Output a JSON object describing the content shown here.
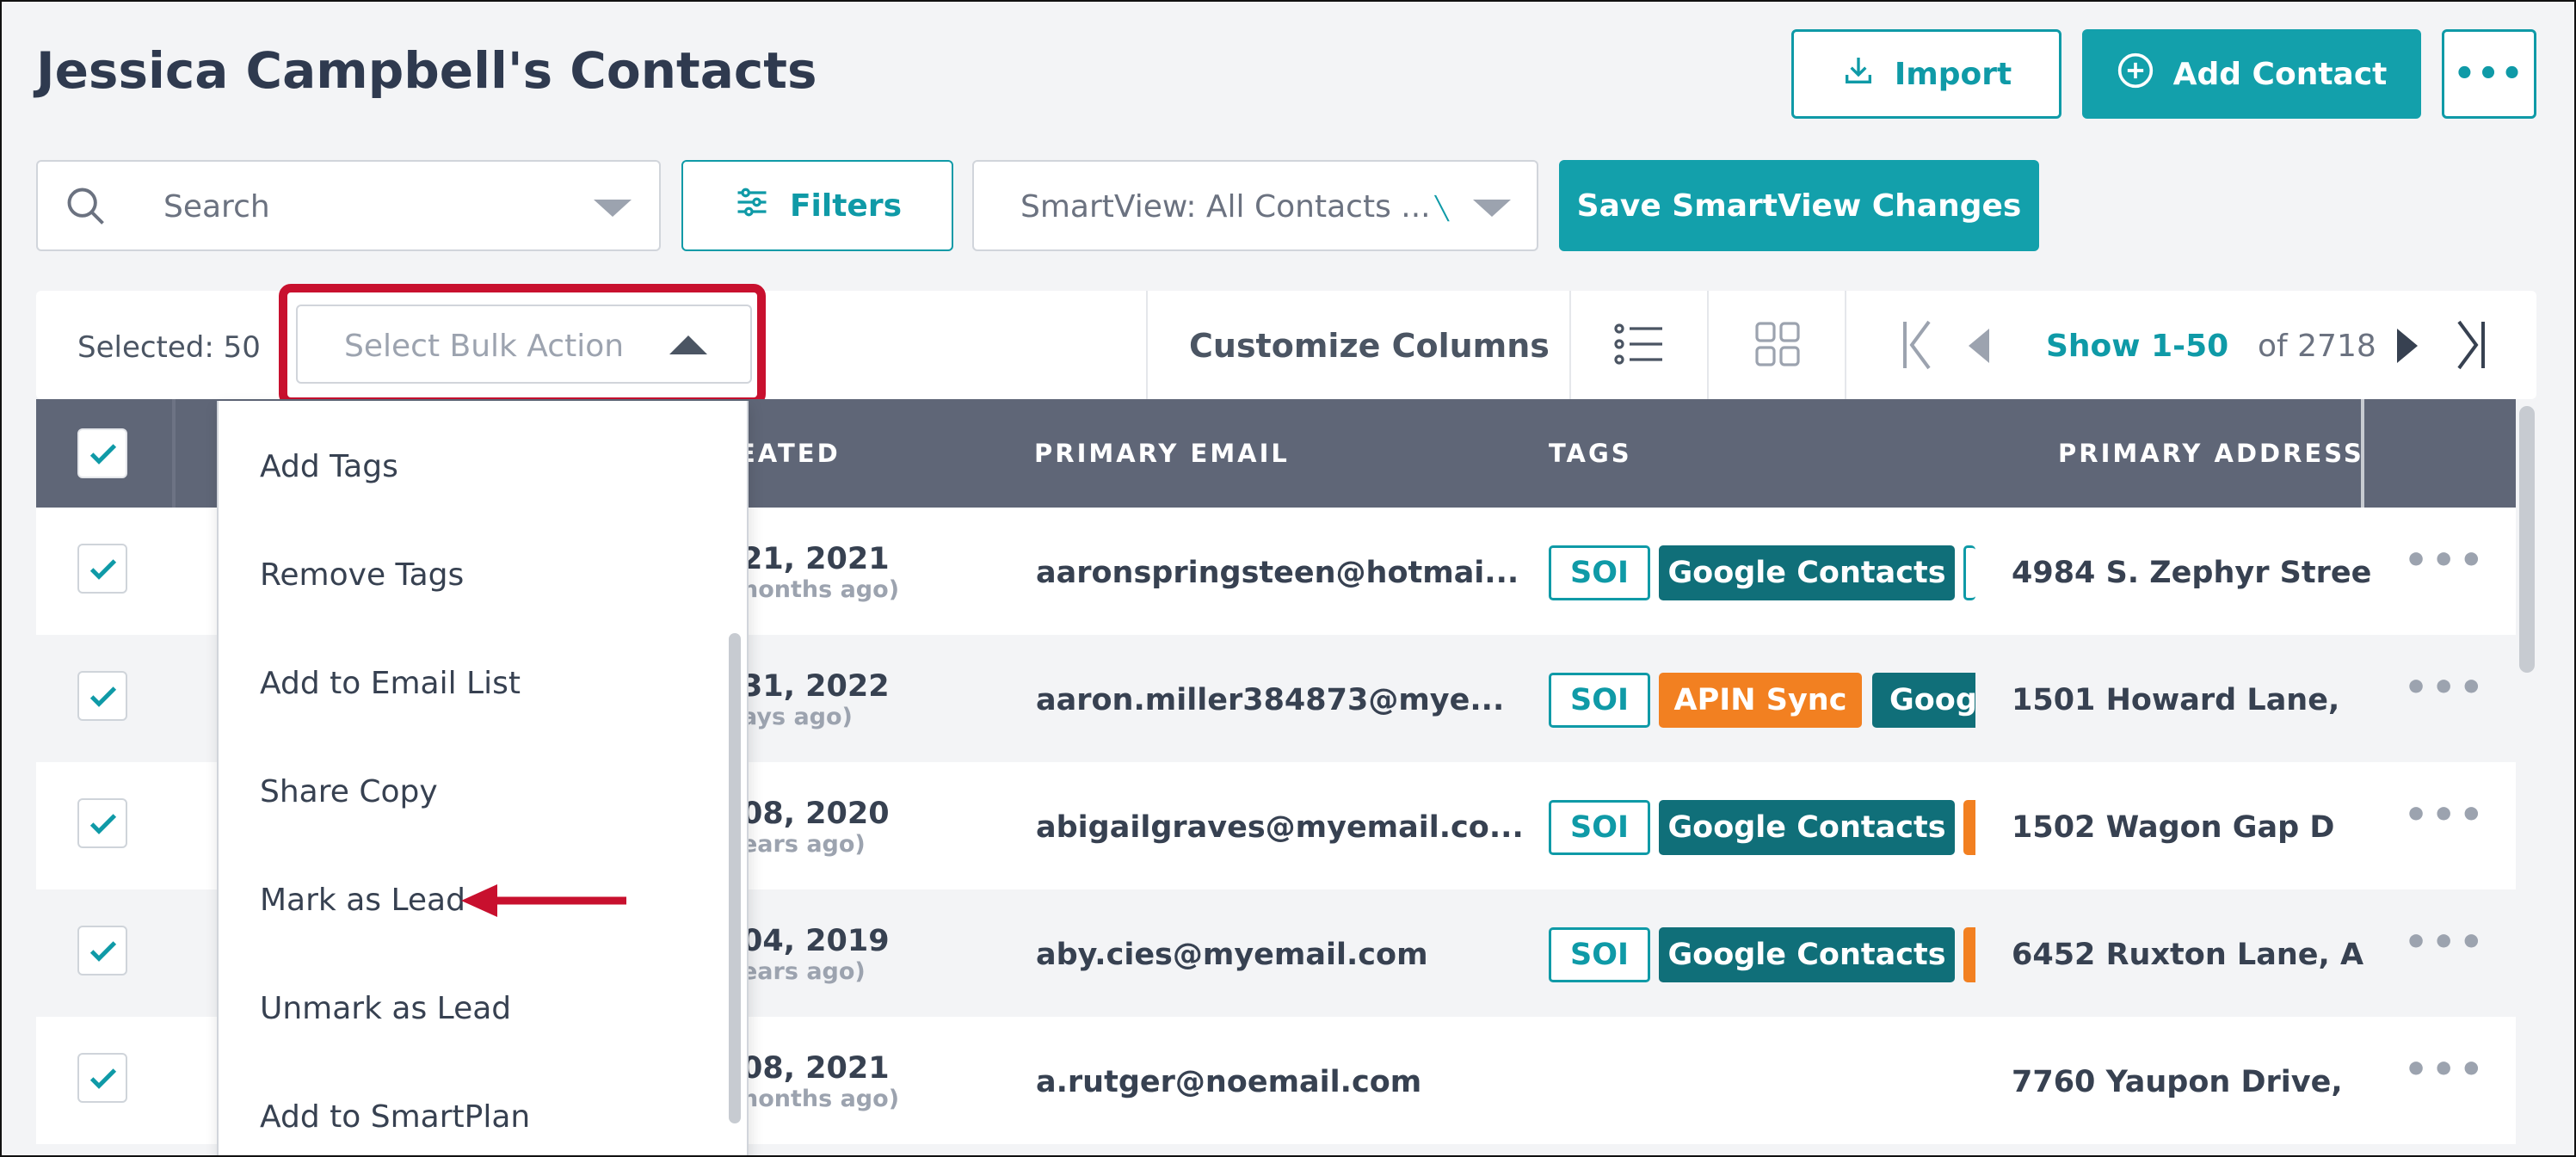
{
  "header": {
    "title": "Jessica Campbell's Contacts",
    "import_label": "Import",
    "add_contact_label": "Add Contact"
  },
  "search": {
    "placeholder": "Search"
  },
  "filters": {
    "label": "Filters"
  },
  "smartview": {
    "label": "SmartView: All Contacts ..."
  },
  "save_smartview": {
    "label": "Save SmartView Changes"
  },
  "toolbar": {
    "selected": "Selected: 50",
    "bulk_action_placeholder": "Select Bulk Action",
    "customize_columns": "Customize Columns",
    "pager_show": "Show 1-50",
    "pager_of": "of 2718"
  },
  "table": {
    "headers": [
      "EATED",
      "PRIMARY EMAIL",
      "TAGS",
      "PRIMARY ADDRESS"
    ],
    "rows": [
      {
        "created": "21, 2021",
        "created_ago": "nonths ago)",
        "email": "aaronspringsteen@hotmai...",
        "address": "4984 S. Zephyr Stree",
        "tags": [
          "SOI",
          "Google Contacts",
          ""
        ]
      },
      {
        "created": "31, 2022",
        "created_ago": "ays ago)",
        "email": "aaron.miller384873@mye...",
        "address": "1501 Howard Lane,",
        "tags": [
          "SOI",
          "APIN Sync",
          "Goog"
        ]
      },
      {
        "created": "08, 2020",
        "created_ago": "ears ago)",
        "email": "abigailgraves@myemail.co...",
        "address": "1502 Wagon Gap D",
        "tags": [
          "SOI",
          "Google Contacts",
          ""
        ]
      },
      {
        "created": "04, 2019",
        "created_ago": "ears ago)",
        "email": "aby.cies@myemail.com",
        "address": "6452 Ruxton Lane, A",
        "tags": [
          "SOI",
          "Google Contacts",
          ""
        ]
      },
      {
        "created": "08, 2021",
        "created_ago": "nonths ago)",
        "email": "a.rutger@noemail.com",
        "address": "7760 Yaupon Drive,",
        "tags": []
      }
    ]
  },
  "bulk_menu": {
    "items": [
      "Add Tags",
      "Remove Tags",
      "Add to Email List",
      "Share Copy",
      "Mark as Lead",
      "Unmark as Lead",
      "Add to SmartPlan"
    ]
  },
  "colors": {
    "accent": "#13a0ab",
    "accent_dark": "#106f79",
    "orange": "#f28021",
    "header_bg": "#5f6677",
    "highlight_red": "#c8102e"
  },
  "icons": [
    "download-icon",
    "plus-circle-icon",
    "more-icon",
    "search-icon",
    "sliders-icon",
    "chevron-down-icon",
    "caret-up-icon",
    "list-view-icon",
    "grid-view-icon",
    "first-page-icon",
    "prev-page-icon",
    "next-page-icon",
    "last-page-icon",
    "check-icon",
    "arrow-annotation"
  ]
}
